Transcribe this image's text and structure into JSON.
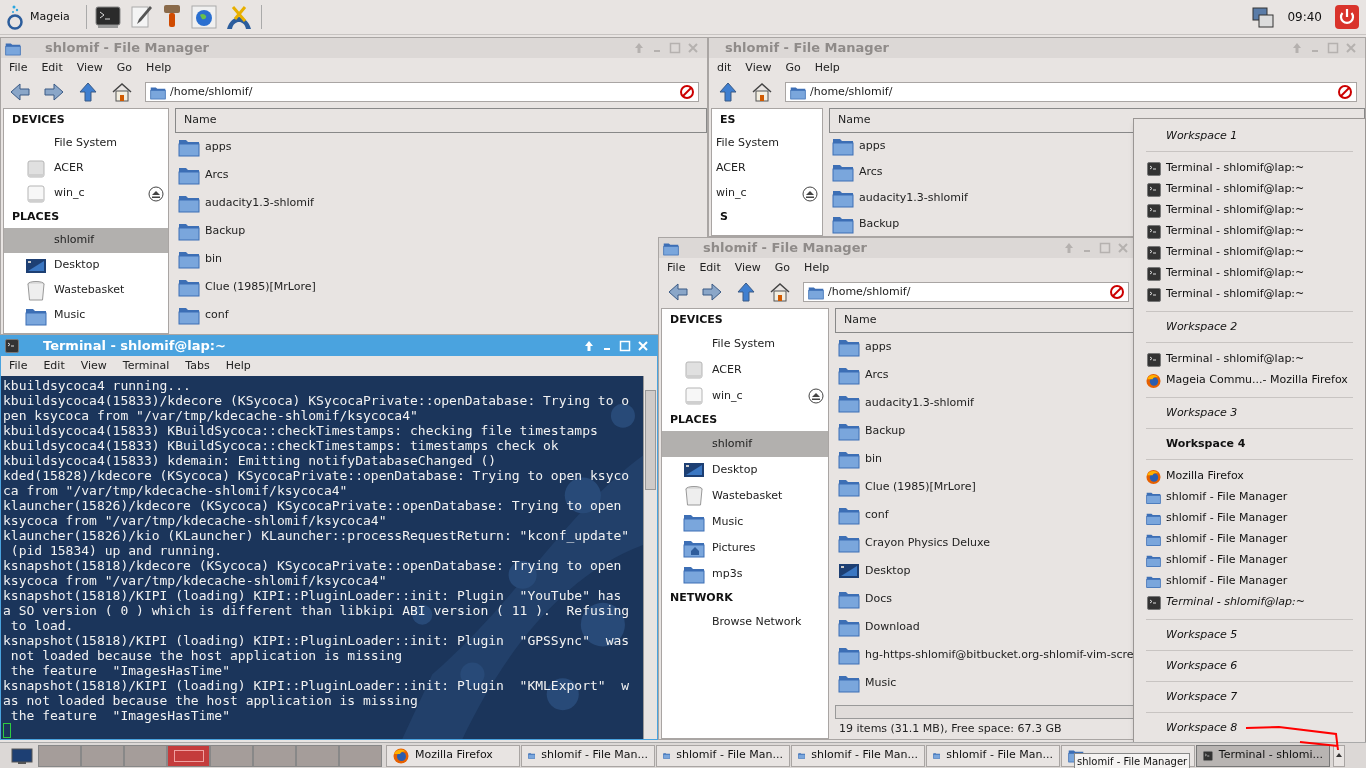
{
  "top_panel": {
    "menu_label": "Mageia",
    "clock": "09:40"
  },
  "windows": [
    {
      "title": "shlomif - File Manager",
      "active": false,
      "menu": [
        "File",
        "Edit",
        "View",
        "Go",
        "Help"
      ],
      "location": "/home/shlomif/",
      "sidebar": [
        {
          "heading": "DEVICES",
          "items": [
            {
              "label": "File System",
              "kind": "blank",
              "selected": false,
              "eject": false
            },
            {
              "label": "ACER",
              "kind": "drive",
              "selected": false,
              "eject": false
            },
            {
              "label": "win_c",
              "kind": "disk",
              "selected": false,
              "eject": true
            }
          ]
        },
        {
          "heading": "PLACES",
          "items": [
            {
              "label": "shlomif",
              "kind": "blank",
              "selected": true,
              "eject": false
            },
            {
              "label": "Desktop",
              "kind": "desktop",
              "selected": false,
              "eject": false
            },
            {
              "label": "Wastebasket",
              "kind": "trash",
              "selected": false,
              "eject": false
            },
            {
              "label": "Music",
              "kind": "folder",
              "selected": false,
              "eject": false
            }
          ]
        }
      ],
      "column": "Name",
      "files": [
        {
          "name": "apps",
          "kind": "folder"
        },
        {
          "name": "Arcs",
          "kind": "folder"
        },
        {
          "name": "audacity1.3-shlomif",
          "kind": "folder"
        },
        {
          "name": "Backup",
          "kind": "folder"
        },
        {
          "name": "bin",
          "kind": "folder"
        },
        {
          "name": "Clue (1985)[MrLore]",
          "kind": "folder"
        },
        {
          "name": "conf",
          "kind": "folder"
        }
      ]
    },
    {
      "title": "shlomif - File Manager",
      "active": false,
      "menu": [
        "dit",
        "View",
        "Go",
        "Help"
      ],
      "location": "/home/shlomif/",
      "sidebar": [
        {
          "heading": "ES",
          "items": [
            {
              "label": "File System",
              "kind": "blank",
              "selected": false,
              "eject": false
            },
            {
              "label": "ACER",
              "kind": "blank",
              "selected": false,
              "eject": false
            },
            {
              "label": "win_c",
              "kind": "blank",
              "selected": false,
              "eject": true
            }
          ]
        },
        {
          "heading": "S"
        }
      ],
      "column": "Name",
      "files": [
        {
          "name": "apps",
          "kind": "folder"
        },
        {
          "name": "Arcs",
          "kind": "folder"
        },
        {
          "name": "audacity1.3-shlomif",
          "kind": "folder"
        },
        {
          "name": "Backup",
          "kind": "folder"
        }
      ]
    },
    {
      "title": "shlomif - File Manager",
      "active": false,
      "menu": [
        "File",
        "Edit",
        "View",
        "Go",
        "Help"
      ],
      "location": "/home/shlomif/",
      "sidebar": [
        {
          "heading": "DEVICES",
          "items": [
            {
              "label": "File System",
              "kind": "blank",
              "selected": false,
              "eject": false
            },
            {
              "label": "ACER",
              "kind": "drive",
              "selected": false,
              "eject": false
            },
            {
              "label": "win_c",
              "kind": "disk",
              "selected": false,
              "eject": true
            }
          ]
        },
        {
          "heading": "PLACES",
          "items": [
            {
              "label": "shlomif",
              "kind": "blank",
              "selected": true,
              "eject": false
            },
            {
              "label": "Desktop",
              "kind": "desktop",
              "selected": false,
              "eject": false
            },
            {
              "label": "Wastebasket",
              "kind": "trash",
              "selected": false,
              "eject": false
            },
            {
              "label": "Music",
              "kind": "folder",
              "selected": false,
              "eject": false
            },
            {
              "label": "Pictures",
              "kind": "pictures",
              "selected": false,
              "eject": false
            },
            {
              "label": "mp3s",
              "kind": "folder",
              "selected": false,
              "eject": false
            }
          ]
        },
        {
          "heading": "NETWORK",
          "items": [
            {
              "label": "Browse Network",
              "kind": "blank",
              "selected": false,
              "eject": false
            }
          ]
        }
      ],
      "column": "Name",
      "files": [
        {
          "name": "apps",
          "kind": "folder"
        },
        {
          "name": "Arcs",
          "kind": "folder"
        },
        {
          "name": "audacity1.3-shlomif",
          "kind": "folder"
        },
        {
          "name": "Backup",
          "kind": "folder"
        },
        {
          "name": "bin",
          "kind": "folder"
        },
        {
          "name": "Clue (1985)[MrLore]",
          "kind": "folder"
        },
        {
          "name": "conf",
          "kind": "folder"
        },
        {
          "name": "Crayon Physics Deluxe",
          "kind": "folder"
        },
        {
          "name": "Desktop",
          "kind": "desktop"
        },
        {
          "name": "Docs",
          "kind": "folder"
        },
        {
          "name": "Download",
          "kind": "folder"
        },
        {
          "name": "hg-https-shlomif@bitbucket.org-shlomif-vim-scre",
          "kind": "folder"
        },
        {
          "name": "Music",
          "kind": "folder"
        }
      ],
      "status": "19 items (31.1 MB), Free space: 67.3 GB"
    }
  ],
  "terminal": {
    "title": "Terminal - shlomif@lap:~",
    "active": true,
    "menu": [
      "File",
      "Edit",
      "View",
      "Terminal",
      "Tabs",
      "Help"
    ],
    "lines": [
      "kbuildsycoca4 running...",
      "kbuildsycoca4(15833)/kdecore (KSycoca) KSycocaPrivate::openDatabase: Trying to o",
      "pen ksycoca from \"/var/tmp/kdecache-shlomif/ksycoca4\"",
      "kbuildsycoca4(15833) KBuildSycoca::checkTimestamps: checking file timestamps",
      "kbuildsycoca4(15833) KBuildSycoca::checkTimestamps: timestamps check ok",
      "kbuildsycoca4(15833) kdemain: Emitting notifyDatabaseChanged ()",
      "kded(15828)/kdecore (KSycoca) KSycocaPrivate::openDatabase: Trying to open ksyco",
      "ca from \"/var/tmp/kdecache-shlomif/ksycoca4\"",
      "klauncher(15826)/kdecore (KSycoca) KSycocaPrivate::openDatabase: Trying to open",
      "ksycoca from \"/var/tmp/kdecache-shlomif/ksycoca4\"",
      "klauncher(15826)/kio (KLauncher) KLauncher::processRequestReturn: \"kconf_update\"",
      " (pid 15834) up and running.",
      "ksnapshot(15818)/kdecore (KSycoca) KSycocaPrivate::openDatabase: Trying to open",
      "ksycoca from \"/var/tmp/kdecache-shlomif/ksycoca4\"",
      "ksnapshot(15818)/KIPI (loading) KIPI::PluginLoader::init: Plugin  \"YouTube\" has",
      "a SO version ( 0 ) which is different than libkipi ABI version ( 11 ).  Refusing",
      " to load.",
      "ksnapshot(15818)/KIPI (loading) KIPI::PluginLoader::init: Plugin  \"GPSSync\"  was",
      " not loaded because the host application is missing",
      " the feature  \"ImagesHasTime\"",
      "ksnapshot(15818)/KIPI (loading) KIPI::PluginLoader::init: Plugin  \"KMLExport\"  w",
      "as not loaded because the host application is missing",
      " the feature  \"ImagesHasTime\""
    ]
  },
  "workspace_menu": {
    "workspaces": [
      {
        "name": "Workspace 1",
        "selected": false,
        "windows": [
          {
            "title": "Terminal - shlomif@lap:~",
            "kind": "terminal",
            "minimized": false
          },
          {
            "title": "Terminal - shlomif@lap:~",
            "kind": "terminal",
            "minimized": false
          },
          {
            "title": "Terminal - shlomif@lap:~",
            "kind": "terminal",
            "minimized": false
          },
          {
            "title": "Terminal - shlomif@lap:~",
            "kind": "terminal",
            "minimized": false
          },
          {
            "title": "Terminal - shlomif@lap:~",
            "kind": "terminal",
            "minimized": false
          },
          {
            "title": "Terminal - shlomif@lap:~",
            "kind": "terminal",
            "minimized": false
          },
          {
            "title": "Terminal - shlomif@lap:~",
            "kind": "terminal",
            "minimized": false
          }
        ]
      },
      {
        "name": "Workspace 2",
        "selected": false,
        "windows": [
          {
            "title": "Terminal - shlomif@lap:~",
            "kind": "terminal",
            "minimized": false
          },
          {
            "title": "Mageia Commu...- Mozilla Firefox",
            "kind": "firefox",
            "minimized": false
          }
        ]
      },
      {
        "name": "Workspace 3",
        "selected": false
      },
      {
        "name": "Workspace 4",
        "selected": true,
        "windows": [
          {
            "title": "Mozilla Firefox",
            "kind": "firefox",
            "minimized": false
          },
          {
            "title": "shlomif - File Manager",
            "kind": "folder",
            "minimized": false
          },
          {
            "title": "shlomif - File Manager",
            "kind": "folder",
            "minimized": false
          },
          {
            "title": "shlomif - File Manager",
            "kind": "folder",
            "minimized": false
          },
          {
            "title": "shlomif - File Manager",
            "kind": "folder",
            "minimized": false
          },
          {
            "title": "shlomif - File Manager",
            "kind": "folder",
            "minimized": false
          },
          {
            "title": "Terminal - shlomif@lap:~",
            "kind": "terminal",
            "minimized": true
          }
        ]
      },
      {
        "name": "Workspace 5",
        "selected": false
      },
      {
        "name": "Workspace 6",
        "selected": false
      },
      {
        "name": "Workspace 7",
        "selected": false
      },
      {
        "name": "Workspace 8",
        "selected": false
      }
    ]
  },
  "taskbar": {
    "pager": [
      {
        "selected": false
      },
      {
        "selected": false
      },
      {
        "selected": false
      },
      {
        "selected": true
      },
      {
        "selected": false
      },
      {
        "selected": false
      },
      {
        "selected": false
      },
      {
        "selected": false
      }
    ],
    "tasks": [
      {
        "label": "Mozilla Firefox",
        "kind": "firefox",
        "selected": false
      },
      {
        "label": "shlomif - File Man...",
        "kind": "folder",
        "selected": false
      },
      {
        "label": "shlomif - File Man...",
        "kind": "folder",
        "selected": false
      },
      {
        "label": "shlomif - File Man...",
        "kind": "folder",
        "selected": false
      },
      {
        "label": "shlomif - File Man...",
        "kind": "folder",
        "selected": false
      },
      {
        "kind": "folder",
        "selected": false
      },
      {
        "label": "Terminal - shlomi...",
        "kind": "terminal",
        "selected": true
      }
    ],
    "tooltip": "shlomif - File Manager"
  }
}
